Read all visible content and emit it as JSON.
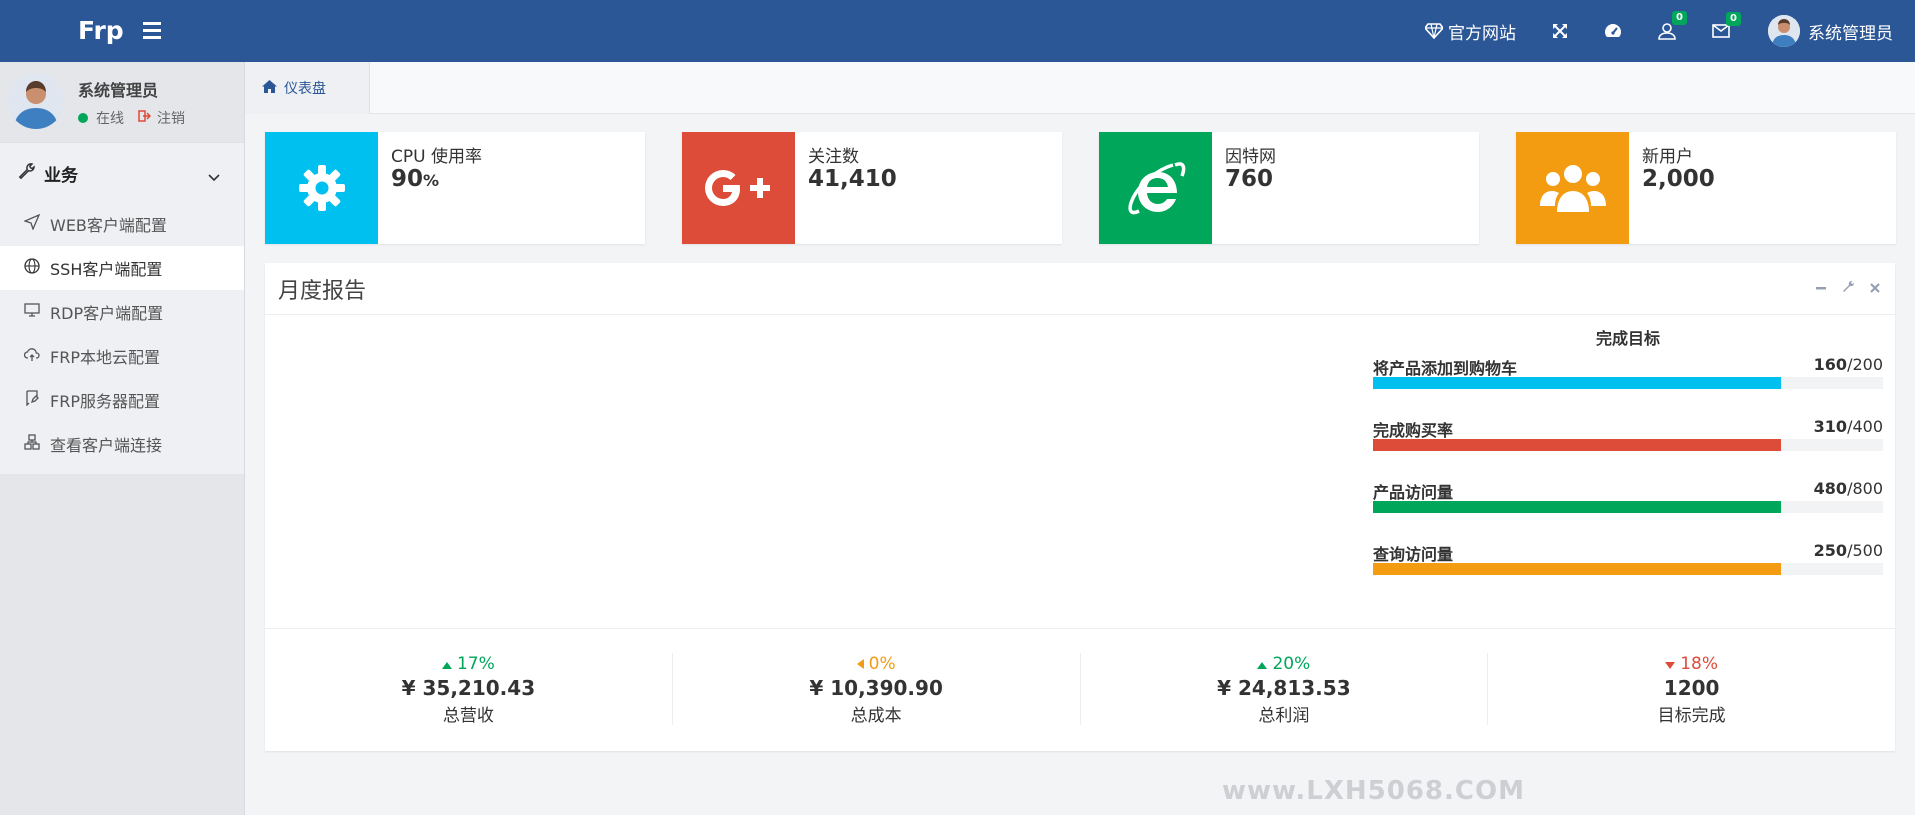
{
  "app": {
    "brand": "Frp"
  },
  "header": {
    "official_site_label": "官方网站",
    "notifications_count": "0",
    "messages_count": "0",
    "user_name": "系统管理员"
  },
  "sidebar": {
    "user_name": "系统管理员",
    "status_label": "在线",
    "logout_label": "注销",
    "section_label": "业务",
    "items": [
      {
        "label": "WEB客户端配置",
        "icon": "send-icon"
      },
      {
        "label": "SSH客户端配置",
        "icon": "globe-icon"
      },
      {
        "label": "RDP客户端配置",
        "icon": "monitor-icon"
      },
      {
        "label": "FRP本地云配置",
        "icon": "cloud-upload-icon"
      },
      {
        "label": "FRP服务器配置",
        "icon": "bookmark-edit-icon"
      },
      {
        "label": "查看客户端连接",
        "icon": "network-icon"
      }
    ]
  },
  "tabs": [
    {
      "label": "仪表盘",
      "icon": "home-icon"
    }
  ],
  "info_boxes": [
    {
      "title": "CPU 使用率",
      "value": "90",
      "unit": "%",
      "color": "#00c0ef",
      "icon": "gear-icon"
    },
    {
      "title": "关注数",
      "value": "41,410",
      "color": "#dd4b39",
      "icon": "google-plus-icon"
    },
    {
      "title": "因特网",
      "value": "760",
      "color": "#00a65a",
      "icon": "internet-explorer-icon"
    },
    {
      "title": "新用户",
      "value": "2,000",
      "color": "#f39c12",
      "icon": "users-icon"
    }
  ],
  "report": {
    "title": "月度报告",
    "goals_title": "完成目标",
    "goals": [
      {
        "label": "将产品添加到购物车",
        "current": "160",
        "total": "/200",
        "progress": 0.8,
        "color": "#00c0ef"
      },
      {
        "label": "完成购买率",
        "current": "310",
        "total": "/400",
        "progress": 0.8,
        "color": "#dd4b39"
      },
      {
        "label": "产品访问量",
        "current": "480",
        "total": "/800",
        "progress": 0.8,
        "color": "#00a65a"
      },
      {
        "label": "查询访问量",
        "current": "250",
        "total": "/500",
        "progress": 0.8,
        "color": "#f39c12"
      }
    ],
    "stats": [
      {
        "percent": "17%",
        "trend": "up",
        "color": "#00a65a",
        "amount": "¥ 35,210.43",
        "label": "总营收"
      },
      {
        "percent": "0%",
        "trend": "left",
        "color": "#f39c12",
        "amount": "¥ 10,390.90",
        "label": "总成本"
      },
      {
        "percent": "20%",
        "trend": "up",
        "color": "#00a65a",
        "amount": "¥ 24,813.53",
        "label": "总利润"
      },
      {
        "percent": "18%",
        "trend": "down",
        "color": "#dd4b39",
        "amount": "1200",
        "label": "目标完成"
      }
    ]
  },
  "watermark": "www.LXH5068.COM"
}
